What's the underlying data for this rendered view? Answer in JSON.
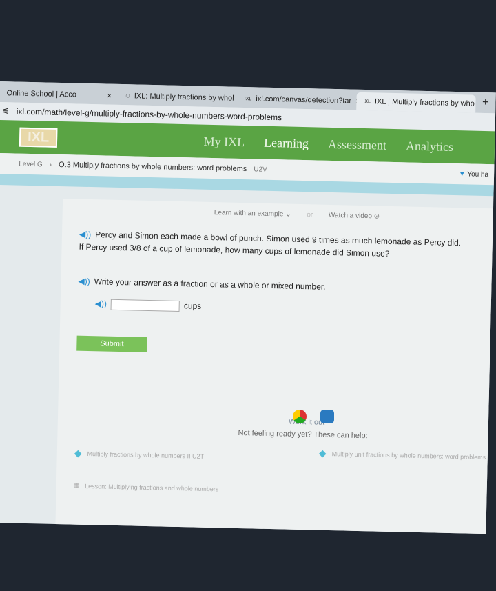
{
  "browser": {
    "tabs": [
      {
        "label": "Online School | Acco",
        "active": false
      },
      {
        "label": "IXL: Multiply fractions by whol",
        "active": false
      },
      {
        "label": "ixl.com/canvas/detection?tar",
        "active": false
      },
      {
        "label": "IXL | Multiply fractions by who",
        "active": true
      }
    ],
    "close": "×",
    "new_tab": "+",
    "url": "ixl.com/math/level-g/multiply-fractions-by-whole-numbers-word-problems"
  },
  "nav": {
    "logo": "IXL",
    "items": [
      "My IXL",
      "Learning",
      "Assessment",
      "Analytics"
    ],
    "active": "Learning",
    "color": "#5aa444"
  },
  "breadcrumb": {
    "level": "Level G",
    "skill": "O.3 Multiply fractions by whole numbers: word problems",
    "code": "U2V",
    "status": "You ha"
  },
  "main": {
    "learn_example": "Learn with an example",
    "or": "or",
    "watch_video": "Watch a video",
    "question": "Percy and Simon each made a bowl of punch. Simon used 9 times as much lemonade as Percy did. If Percy used 3/8 of a cup of lemonade, how many cups of lemonade did Simon use?",
    "instruction": "Write your answer as a fraction or as a whole or mixed number.",
    "answer_value": "",
    "unit": "cups",
    "submit": "Submit",
    "work_it_out": "Work it out",
    "help_prompt": "Not feeling ready yet? These can help:",
    "help_items": [
      "Multiply fractions by whole numbers II  U2T",
      "Multiply unit fractions by whole numbers: word problems",
      "Lesson: Multiplying fractions and whole numbers"
    ]
  }
}
